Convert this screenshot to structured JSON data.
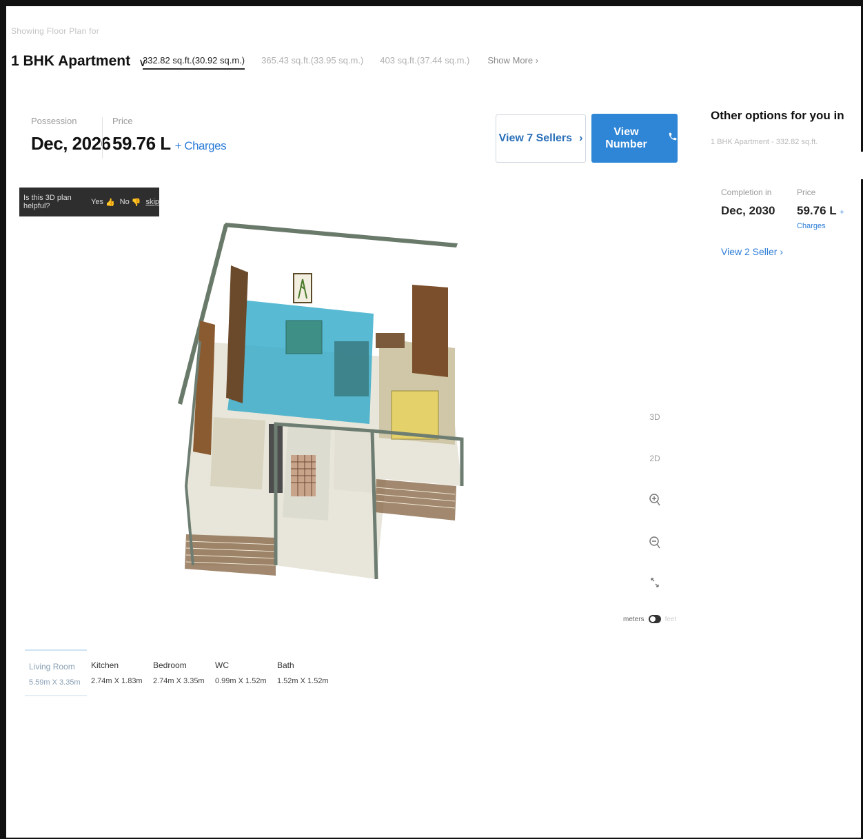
{
  "header": {
    "showing_label": "Showing Floor Plan for",
    "config": "1 BHK Apartment",
    "size_tabs": [
      {
        "label": "332.82 sq.ft.(30.92 sq.m.)",
        "active": true
      },
      {
        "label": "365.43 sq.ft.(33.95 sq.m.)",
        "active": false
      },
      {
        "label": "403 sq.ft.(37.44 sq.m.)",
        "active": false
      }
    ],
    "show_more": "Show More"
  },
  "summary": {
    "possession_label": "Possession",
    "possession_value": "Dec, 2026",
    "price_label": "Price",
    "price_value": "59.76 L",
    "charges_link": "+ Charges"
  },
  "actions": {
    "view_sellers": "View 7 Sellers",
    "view_number": "View Number"
  },
  "feedback": {
    "question": "Is this 3D plan helpful?",
    "yes": "Yes",
    "no": "No",
    "skip": "skip"
  },
  "other_options": {
    "title": "Other options for you in",
    "subtitle": "1 BHK Apartment - 332.82 sq.ft.",
    "completion_label": "Completion in",
    "completion_value": "Dec, 2030",
    "price_label": "Price",
    "price_value": "59.76 L",
    "charges_link": "+ Charges",
    "view_sellers": "View 2 Seller"
  },
  "viewer_controls": {
    "view_3d": "3D",
    "view_2d": "2D",
    "unit_metric": "meters",
    "unit_imperial": "feet"
  },
  "rooms": [
    {
      "name": "Living Room",
      "dims": "5.59m X 3.35m",
      "active": true
    },
    {
      "name": "Kitchen",
      "dims": "2.74m X 1.83m",
      "active": false
    },
    {
      "name": "Bedroom",
      "dims": "2.74m X 3.35m",
      "active": false
    },
    {
      "name": "WC",
      "dims": "0.99m X 1.52m",
      "active": false
    },
    {
      "name": "Bath",
      "dims": "1.52m X 1.52m",
      "active": false
    }
  ],
  "colors": {
    "accent_blue": "#2f86d6",
    "link_blue": "#2d7dd8",
    "living_room_highlight": "#2aa7c8"
  }
}
